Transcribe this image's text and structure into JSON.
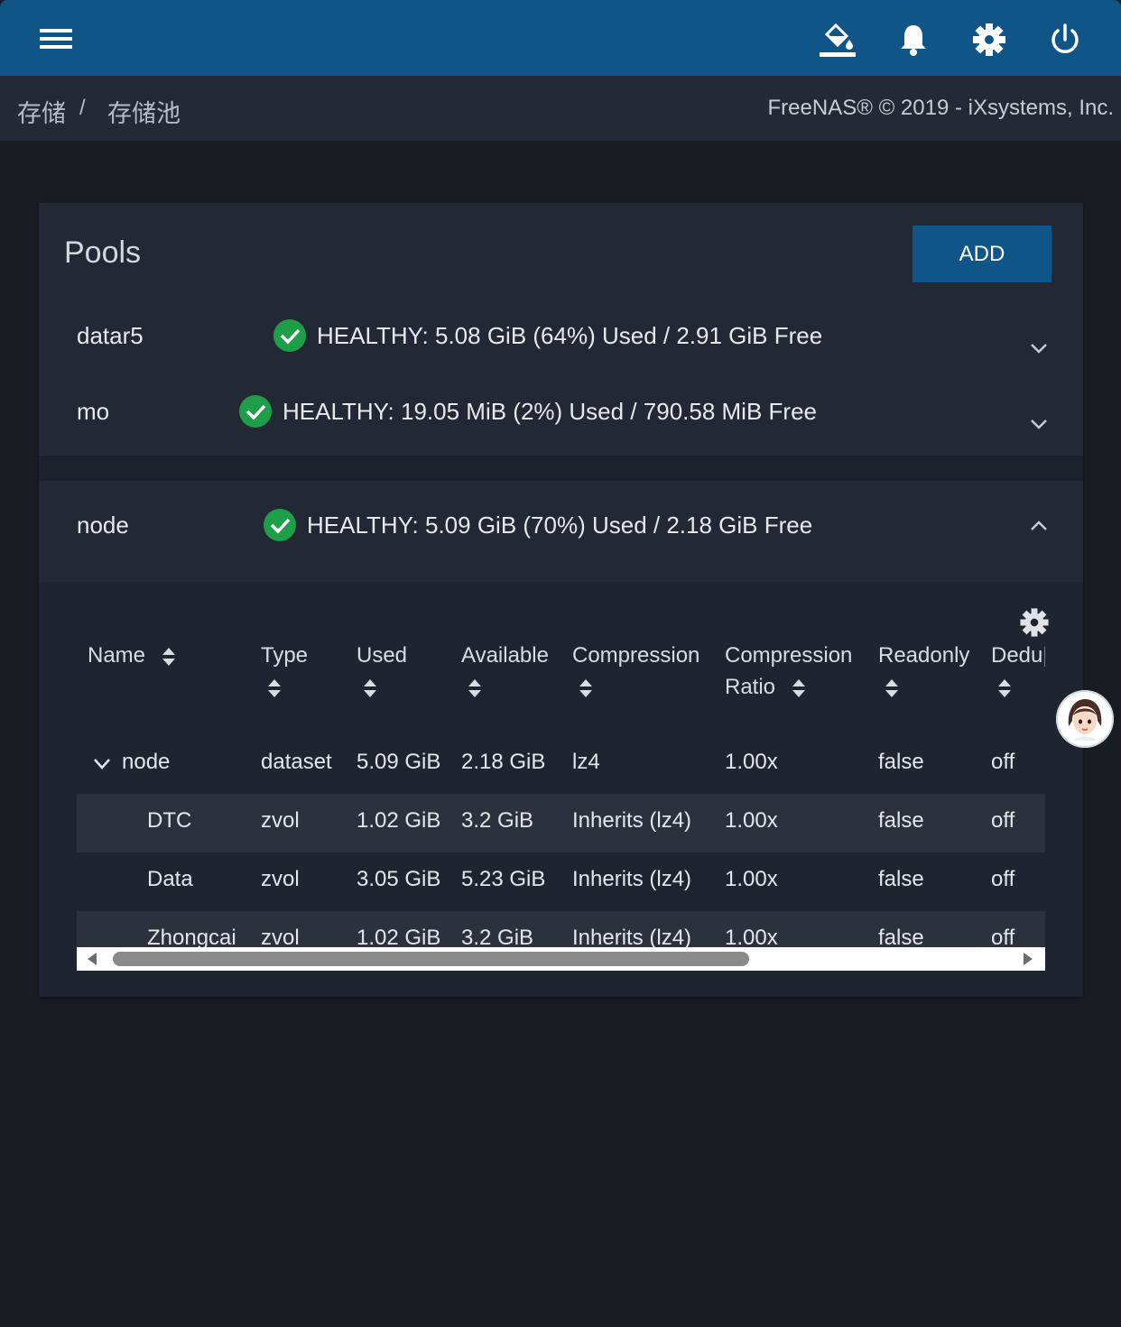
{
  "topbar": {
    "menu_icon": "hamburger-menu-icon",
    "icons": [
      "theme-paint-bucket-icon",
      "notifications-bell-icon",
      "settings-gear-icon",
      "power-icon"
    ],
    "color": "#0f5588"
  },
  "breadcrumb": {
    "items": [
      "存储",
      "存储池"
    ],
    "separator": "/"
  },
  "copyright": "FreeNAS® © 2019 - iXsystems, Inc.",
  "pools_card": {
    "title": "Pools",
    "add_label": "ADD",
    "pools": [
      {
        "name": "datar5",
        "status": "HEALTHY: 5.08 GiB (64%) Used / 2.91 GiB Free",
        "expanded": false
      },
      {
        "name": "mo",
        "status": "HEALTHY: 19.05 MiB (2%) Used / 790.58 MiB Free",
        "expanded": false
      },
      {
        "name": "node",
        "status": "HEALTHY: 5.09 GiB (70%) Used / 2.18 GiB Free",
        "expanded": true
      }
    ]
  },
  "dataset_table": {
    "columns": [
      {
        "line1": "Name",
        "line2": ""
      },
      {
        "line1": "Type",
        "line2": ""
      },
      {
        "line1": "Used",
        "line2": ""
      },
      {
        "line1": "Available",
        "line2": ""
      },
      {
        "line1": "Compression",
        "line2": ""
      },
      {
        "line1": "Compression",
        "line2": "Ratio"
      },
      {
        "line1": "Readonly",
        "line2": ""
      },
      {
        "line1": "Dedu|",
        "line2": ""
      }
    ],
    "rows": [
      {
        "name": "node",
        "type": "dataset",
        "used": "5.09 GiB",
        "available": "2.18 GiB",
        "compression": "lz4",
        "ratio": "1.00x",
        "readonly": "false",
        "dedup": "off"
      },
      {
        "name": "DTC",
        "type": "zvol",
        "used": "1.02 GiB",
        "available": "3.2 GiB",
        "compression": "Inherits (lz4)",
        "ratio": "1.00x",
        "readonly": "false",
        "dedup": "off"
      },
      {
        "name": "Data",
        "type": "zvol",
        "used": "3.05 GiB",
        "available": "5.23 GiB",
        "compression": "Inherits (lz4)",
        "ratio": "1.00x",
        "readonly": "false",
        "dedup": "off"
      },
      {
        "name": "Zhongcai",
        "type": "zvol",
        "used": "1.02 GiB",
        "available": "3.2 GiB",
        "compression": "Inherits (lz4)",
        "ratio": "1.00x",
        "readonly": "false",
        "dedup": "off"
      }
    ]
  },
  "colors": {
    "healthy": "#1f9e4a",
    "accent": "#0f5588"
  }
}
